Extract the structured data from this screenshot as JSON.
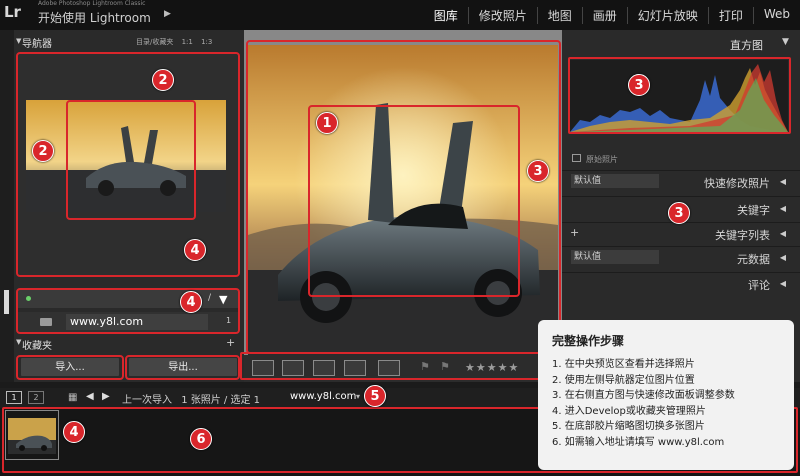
{
  "app": {
    "logo": "Lr",
    "subtitle": "Adobe Photoshop Lightroom Classic",
    "title": "开始使用 Lightroom",
    "title_arrow": "▶"
  },
  "modules": [
    "图库",
    "修改照片",
    "地图",
    "画册",
    "幻灯片放映",
    "打印",
    "Web"
  ],
  "left_panel": {
    "navigator_title": "导航器",
    "navigator_options": [
      "目录/收藏夹",
      "1:1",
      "1:3"
    ],
    "collections_title": "收藏夹",
    "collection_url": "www.y8l.com",
    "collection_count": "1",
    "import_label": "导入...",
    "export_label": "导出..."
  },
  "right_panel": {
    "histogram_title": "直方图",
    "original_photo_label": "原始照片",
    "quick_develop_preset": "默认值",
    "quick_develop_label": "快速修改照片",
    "keywording_label": "关键字",
    "keyword_list_label": "关键字列表",
    "metadata_preset": "默认值",
    "metadata_label": "元数据",
    "comments_label": "评论"
  },
  "toolbar": {
    "stars": "★★★★★"
  },
  "filmstrip": {
    "tab1": "1",
    "tab2": "2",
    "source": "上一次导入",
    "count_text": "1 张照片 / 选定 1",
    "url": "www.y8l.com"
  },
  "popover": {
    "title": "完整操作步骤",
    "steps": [
      "1. 在中央预览区查看并选择照片",
      "2. 使用左侧导航器定位图片位置",
      "3. 在右侧直方图与快速修改面板调整参数",
      "4. 进入Develop或收藏夹管理照片",
      "5. 在底部胶片缩略图切换多张图片",
      "6. 如需输入地址请填写 www.y8l.com"
    ]
  },
  "badges": [
    "1",
    "2",
    "2",
    "3",
    "3",
    "3",
    "4",
    "4",
    "4",
    "5",
    "6"
  ],
  "colors": {
    "annotation_red": "#d9262b",
    "panel_bg": "#2a2a2a",
    "topbar_bg": "#121212"
  }
}
